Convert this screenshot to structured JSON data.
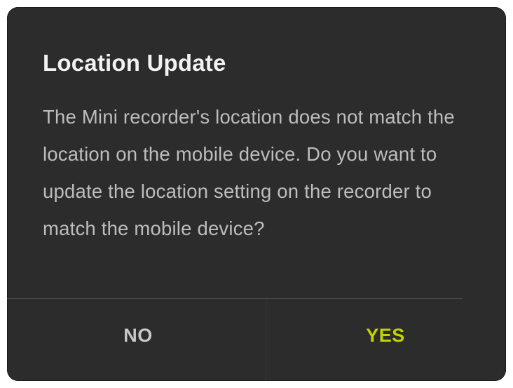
{
  "dialog": {
    "title": "Location Update",
    "message": "The Mini recorder's location does not match the location on the mobile device. Do you want to update the location setting on the recorder to match the mobile device?",
    "buttons": {
      "no_label": "NO",
      "yes_label": "YES"
    }
  },
  "colors": {
    "dialog_background": "#2c2c2c",
    "title_text": "#f2f2f2",
    "message_text": "#bdbdbd",
    "no_button_text": "#c8c8c8",
    "yes_button_accent": "#c2d400"
  }
}
